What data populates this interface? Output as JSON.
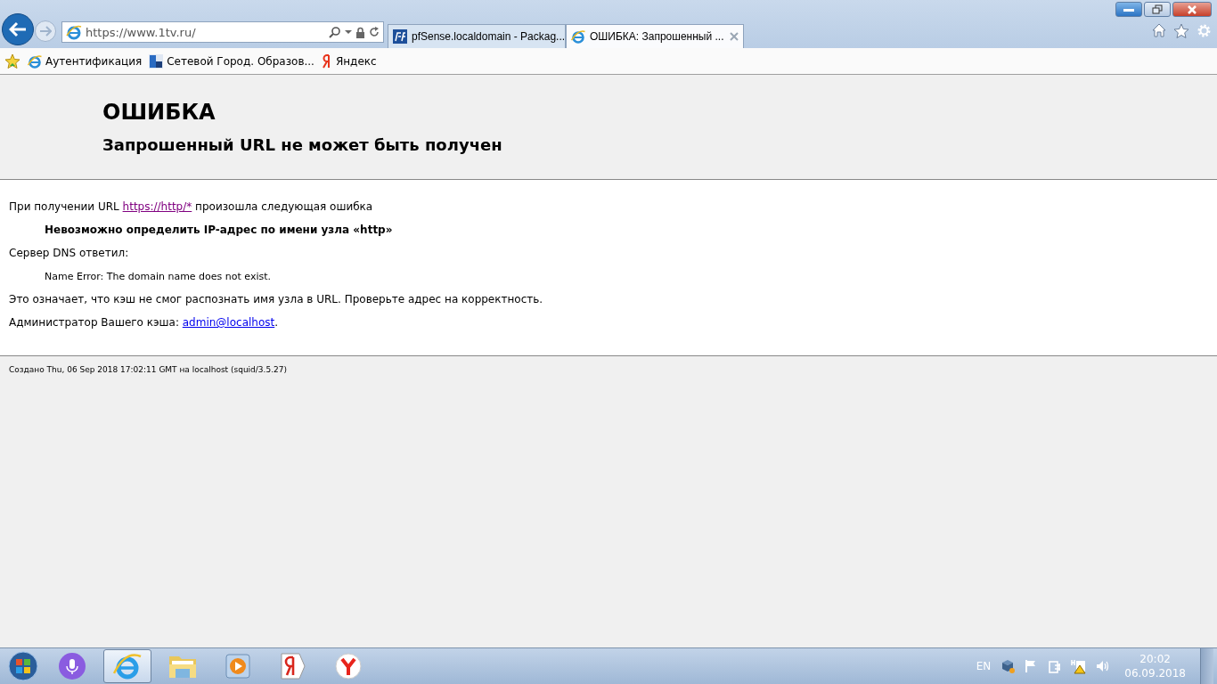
{
  "browser": {
    "address": {
      "value": "https://www.1tv.ru/"
    },
    "tabs": [
      {
        "title": "pfSense.localdomain - Packag...",
        "kind": "pfsense",
        "selected": false
      },
      {
        "title": "ОШИБКА: Запрошенный ...",
        "kind": "ie",
        "selected": true
      }
    ],
    "favorites": [
      {
        "label": "Аутентификация",
        "kind": "ie"
      },
      {
        "label": "Сетевой Город. Образов...",
        "kind": "grid"
      },
      {
        "label": "Яндекс",
        "kind": "yandex"
      }
    ]
  },
  "error_page": {
    "title": "ОШИБКА",
    "subtitle": "Запрошенный URL не может быть получен",
    "intro": {
      "before": "При получении URL ",
      "link": "https://http/*",
      "after": " произошла следующая ошибка"
    },
    "error": "Невозможно определить IP-адрес по имени узла «http»",
    "dns_label": "Сервер DNS ответил:",
    "dns_reply": "Name Error: The domain name does not exist.",
    "explanation": "Это означает, что кэш не смог распознать имя узла в URL. Проверьте адрес на корректность.",
    "admin": {
      "before": "Администратор Вашего кэша: ",
      "link": "admin@localhost",
      "after": "."
    },
    "footer": "Создано Thu, 06 Sep 2018 17:02:11 GMT на localhost (squid/3.5.27)"
  },
  "taskbar": {
    "apps": [
      {
        "kind": "mic",
        "selected": false
      },
      {
        "kind": "ie",
        "selected": true
      },
      {
        "kind": "folder",
        "selected": false
      },
      {
        "kind": "media",
        "selected": false
      },
      {
        "kind": "yandex",
        "selected": false
      },
      {
        "kind": "yabrowser",
        "selected": false
      }
    ],
    "language": "EN",
    "time": "20:02",
    "date": "06.09.2018"
  }
}
